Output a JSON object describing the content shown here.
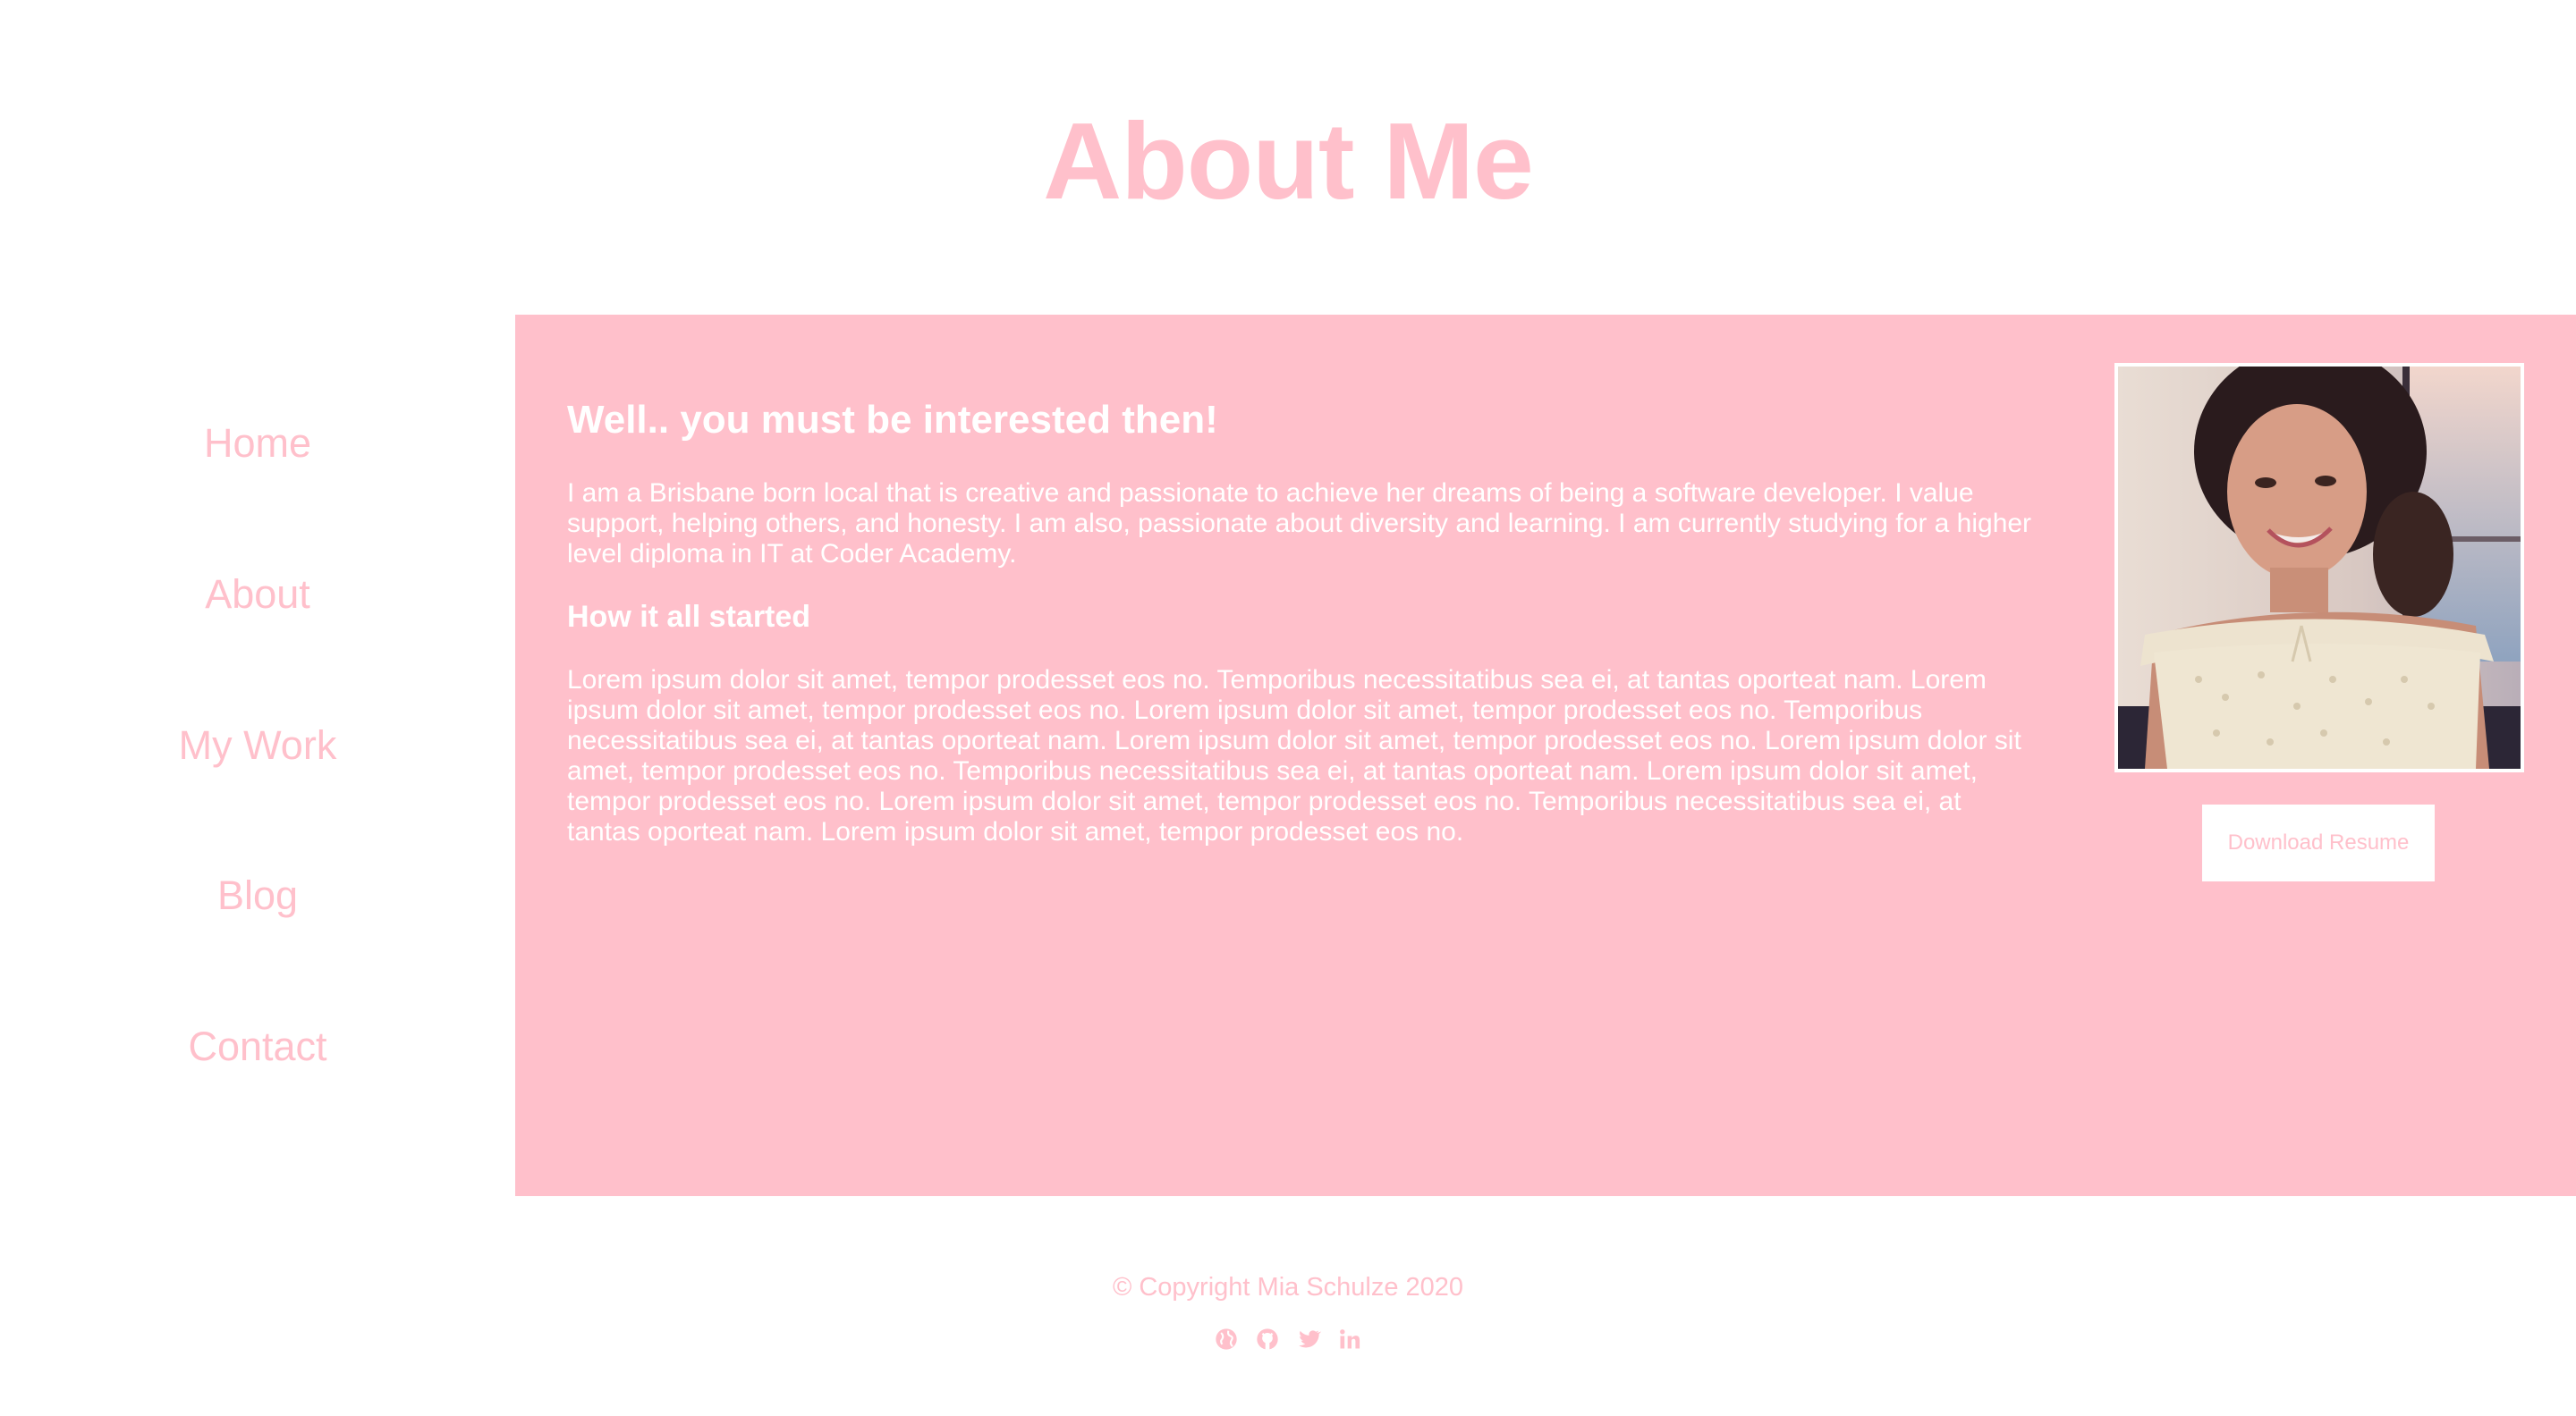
{
  "page": {
    "title": "About Me"
  },
  "nav": {
    "items": [
      {
        "label": "Home"
      },
      {
        "label": "About"
      },
      {
        "label": "My Work"
      },
      {
        "label": "Blog"
      },
      {
        "label": "Contact"
      }
    ]
  },
  "main": {
    "heading": "Well.. you must be interested then!",
    "intro": "I am a Brisbane born local that is creative and passionate to achieve her dreams of being a software developer. I value support, helping others, and honesty. I am also, passionate about diversity and learning. I am currently studying for a higher level diploma in IT at Coder Academy.",
    "subheading": "How it all started",
    "story": "Lorem ipsum dolor sit amet, tempor prodesset eos no. Temporibus necessitatibus sea ei, at tantas oporteat nam. Lorem ipsum dolor sit amet, tempor prodesset eos no. Lorem ipsum dolor sit amet, tempor prodesset eos no. Temporibus necessitatibus sea ei, at tantas oporteat nam. Lorem ipsum dolor sit amet, tempor prodesset eos no. Lorem ipsum dolor sit amet, tempor prodesset eos no. Temporibus necessitatibus sea ei, at tantas oporteat nam. Lorem ipsum dolor sit amet, tempor prodesset eos no. Lorem ipsum dolor sit amet, tempor prodesset eos no. Temporibus necessitatibus sea ei, at tantas oporteat nam. Lorem ipsum dolor sit amet, tempor prodesset eos no.",
    "resume_button": "Download Resume"
  },
  "footer": {
    "copyright": "© Copyright Mia Schulze 2020",
    "social_icons": [
      "globe-icon",
      "github-icon",
      "twitter-icon",
      "linkedin-icon"
    ]
  },
  "colors": {
    "accent": "#ffc0cb",
    "text_on_accent": "#ffffff",
    "background": "#ffffff"
  }
}
